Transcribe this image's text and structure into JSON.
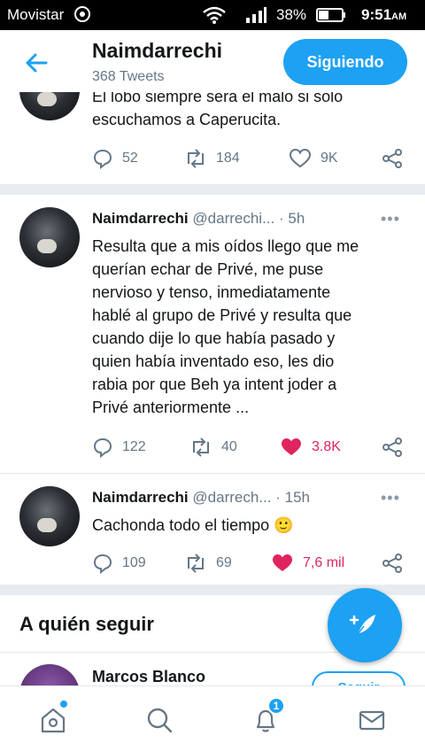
{
  "status_bar": {
    "carrier": "Movistar",
    "battery": "38%",
    "time": "9:51",
    "ampm": "AM"
  },
  "header": {
    "name": "Naimdarrechi",
    "tweet_count": "368 Tweets",
    "follow_label": "Siguiendo"
  },
  "tweets": [
    {
      "text_line1": "El lobo siempre será el malo si solo",
      "text_line2": "escuchamos a Caperucita.",
      "replies": "52",
      "retweets": "184",
      "likes": "9K"
    },
    {
      "name": "Naimdarrechi",
      "handle": "@darrechi...",
      "dot": "·",
      "age": "5h",
      "more": "•••",
      "lines": [
        "Resulta que a mis oídos llego que me",
        "querían echar de Privé, me puse",
        "nervioso y tenso, inmediatamente",
        "hablé al grupo de Privé y resulta que",
        "cuando dije lo que había pasado y",
        "quien había inventado eso, les dio",
        "rabia por que Beh ya intent joder a",
        "Privé anteriormente ..."
      ],
      "replies": "122",
      "retweets": "40",
      "likes": "3.8K"
    },
    {
      "name": "Naimdarrechi",
      "handle": "@darrech...",
      "dot": "·",
      "age": "15h",
      "more": "•••",
      "text": "Cachonda todo el tiempo 🙂",
      "replies": "109",
      "retweets": "69",
      "likes": "7,6 mil"
    }
  ],
  "who_to_follow": {
    "title": "A quién seguir",
    "first_name": "Marcos Blanco",
    "follow_label": "Seguir"
  },
  "nav": {
    "notifications_badge": "1"
  },
  "colors": {
    "accent": "#1da1f2",
    "like": "#e0245e",
    "muted": "#657786"
  }
}
